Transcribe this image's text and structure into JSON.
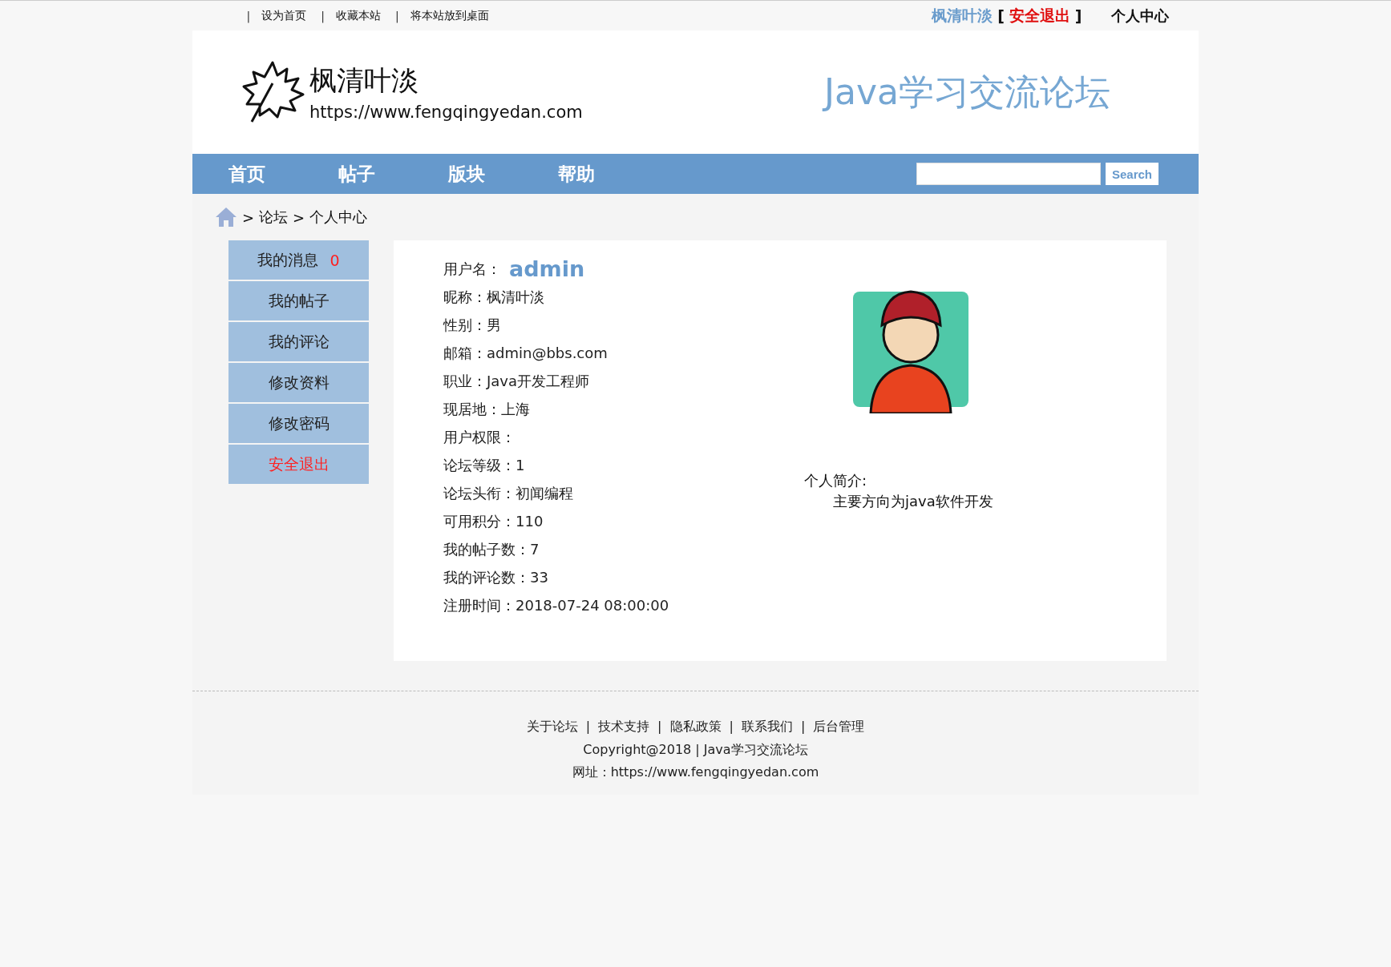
{
  "top_bar": {
    "links": [
      {
        "sep": "|",
        "label": "设为首页"
      },
      {
        "sep": "|",
        "label": "收藏本站"
      },
      {
        "sep": "|",
        "label": "将本站放到桌面"
      }
    ],
    "user": {
      "name": "枫清叶淡",
      "open": "[",
      "logout": "安全退出",
      "close": "]"
    },
    "center": "个人中心"
  },
  "header": {
    "logo_name": "枫清叶淡",
    "logo_url": "https://www.fengqingyedan.com",
    "title": "Java学习交流论坛"
  },
  "nav": {
    "items": [
      {
        "label": "首页"
      },
      {
        "label": "帖子"
      },
      {
        "label": "版块"
      },
      {
        "label": "帮助"
      }
    ],
    "search_button": "Search"
  },
  "breadcrumb": [
    ">",
    "论坛",
    ">",
    "个人中心"
  ],
  "side_menu": [
    {
      "label": "我的消息",
      "count": "0",
      "kind": "normal"
    },
    {
      "label": "我的帖子",
      "kind": "normal"
    },
    {
      "label": "我的评论",
      "kind": "normal"
    },
    {
      "label": "修改资料",
      "kind": "normal"
    },
    {
      "label": "修改密码",
      "kind": "normal"
    },
    {
      "label": "安全退出",
      "kind": "danger"
    }
  ],
  "profile": {
    "username": {
      "label": "用户名：",
      "value": "admin"
    },
    "fields": [
      {
        "label": "昵称：",
        "value": "枫清叶淡"
      },
      {
        "label": "性别：",
        "value": "男"
      },
      {
        "label": "邮箱：",
        "value": "admin@bbs.com"
      },
      {
        "label": "职业：",
        "value": "Java开发工程师"
      },
      {
        "label": "现居地：",
        "value": "上海"
      },
      {
        "label": "用户权限："
      },
      {
        "label": "论坛等级：",
        "value": "1"
      },
      {
        "label": "论坛头衔：",
        "value": "初闻编程"
      },
      {
        "label": "可用积分：",
        "value": "110"
      },
      {
        "label": "我的帖子数：",
        "value": "7"
      },
      {
        "label": "我的评论数：",
        "value": "33"
      },
      {
        "label": "注册时间：",
        "value": "2018-07-24 08:00:00"
      }
    ],
    "bio_label": "个人简介:",
    "bio": "主要方向为java软件开发"
  },
  "footer": {
    "links": [
      {
        "label": "关于论坛",
        "sep": "|"
      },
      {
        "label": "技术支持",
        "sep": "|"
      },
      {
        "label": "隐私政策",
        "sep": "|"
      },
      {
        "label": "联系我们",
        "sep": "|"
      },
      {
        "label": "后台管理"
      }
    ],
    "copyright": "Copyright@2018 | Java学习交流论坛",
    "site": "网址：https://www.fengqingyedan.com"
  }
}
